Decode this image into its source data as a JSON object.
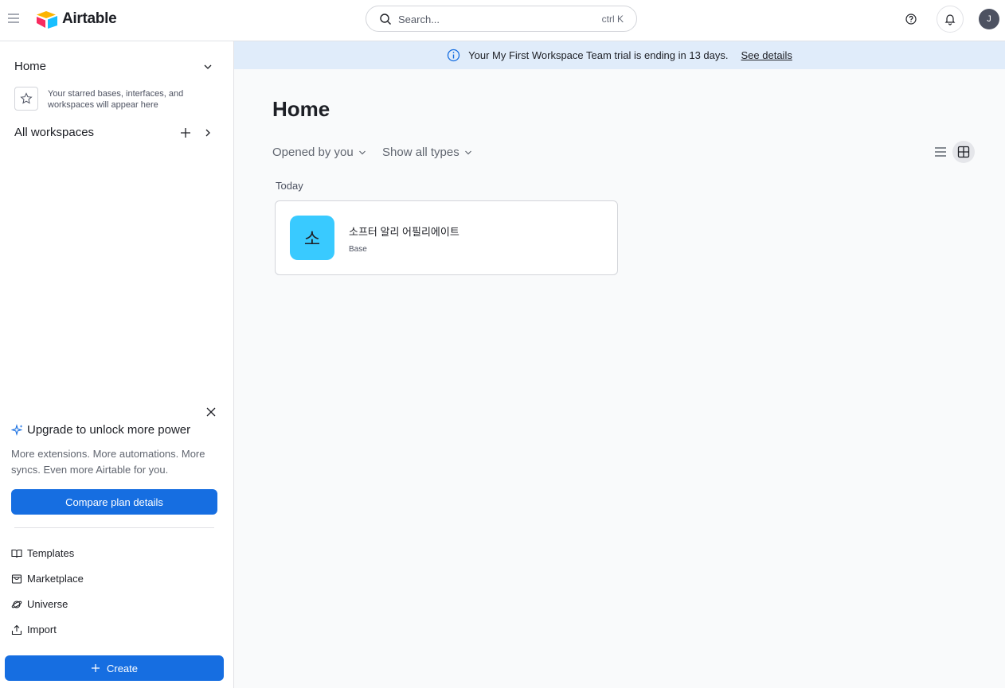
{
  "topbar": {
    "logo_text": "Airtable",
    "search": {
      "placeholder": "Search...",
      "shortcut": "ctrl K"
    },
    "avatar_initial": "J"
  },
  "sidebar": {
    "home_label": "Home",
    "starred_hint": "Your starred bases, interfaces, and workspaces will appear here",
    "workspaces_label": "All workspaces",
    "upgrade": {
      "title": "Upgrade to unlock more power",
      "description": "More extensions. More automations. More syncs. Even more Airtable for you.",
      "button_label": "Compare plan details"
    },
    "links": [
      {
        "label": "Templates",
        "icon": "book-icon"
      },
      {
        "label": "Marketplace",
        "icon": "marketplace-icon"
      },
      {
        "label": "Universe",
        "icon": "planet-icon"
      },
      {
        "label": "Import",
        "icon": "upload-icon"
      }
    ],
    "create_label": "Create"
  },
  "banner": {
    "text": "Your My First Workspace Team trial is ending in 13 days.",
    "link_label": "See details"
  },
  "main": {
    "title": "Home",
    "filters": {
      "opened_by": "Opened by you",
      "types": "Show all types"
    },
    "section_label": "Today",
    "bases": [
      {
        "initial": "소",
        "name": "소프터 알리 어필리에이트",
        "type": "Base",
        "color": "#39caff"
      }
    ]
  },
  "colors": {
    "primary": "#166ee1",
    "banner_bg": "#e0ecfa",
    "main_bg": "#f9fafb"
  }
}
